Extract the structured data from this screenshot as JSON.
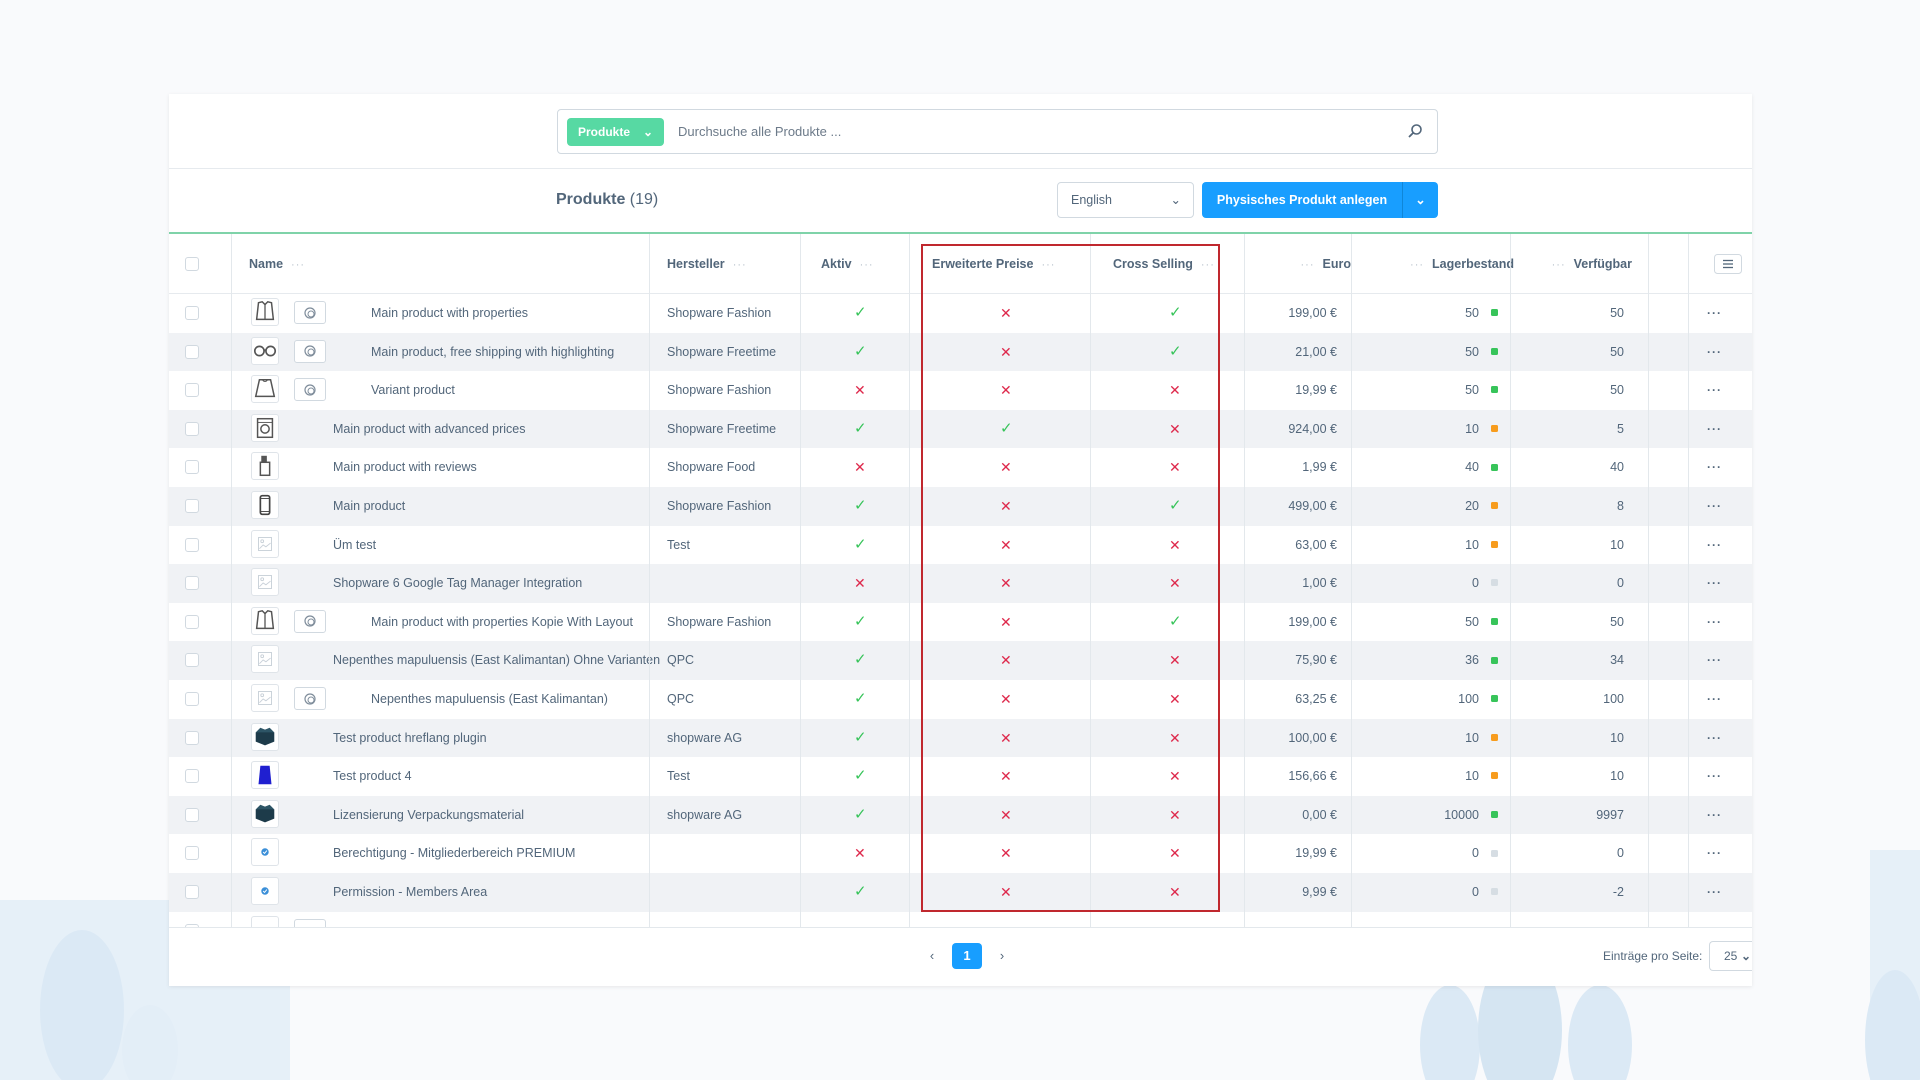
{
  "search": {
    "type_label": "Produkte",
    "placeholder": "Durchsuche alle Produkte ..."
  },
  "header": {
    "title": "Produkte",
    "count": "(19)",
    "language": "English",
    "create_button": "Physisches Produkt anlegen"
  },
  "columns": {
    "name": "Name",
    "manufacturer": "Hersteller",
    "active": "Aktiv",
    "advanced_prices": "Erweiterte Preise",
    "cross_selling": "Cross Selling",
    "price": "Euro",
    "stock": "Lagerbestand",
    "available": "Verfügbar"
  },
  "colors": {
    "accent": "#189eff",
    "success": "#37c45a",
    "danger": "#de294c",
    "warning": "#f79c1d",
    "neutral": "#d6dde3",
    "highlight_box": "#c0282e",
    "search_type": "#57d9a3"
  },
  "rows": [
    {
      "thumb": "jacket",
      "variant": true,
      "name": "Main product with properties",
      "manufacturer": "Shopware Fashion",
      "active": true,
      "advanced_prices": false,
      "cross_selling": true,
      "price": "199,00 €",
      "stock": "50",
      "stock_status": "green",
      "available": "50"
    },
    {
      "thumb": "glasses",
      "variant": true,
      "name": "Main product, free shipping with highlighting",
      "manufacturer": "Shopware Freetime",
      "active": true,
      "advanced_prices": false,
      "cross_selling": true,
      "price": "21,00 €",
      "stock": "50",
      "stock_status": "green",
      "available": "50"
    },
    {
      "thumb": "sweater",
      "variant": true,
      "name": "Variant product",
      "manufacturer": "Shopware Fashion",
      "active": false,
      "advanced_prices": false,
      "cross_selling": false,
      "price": "19,99 €",
      "stock": "50",
      "stock_status": "green",
      "available": "50"
    },
    {
      "thumb": "washer",
      "variant": false,
      "name": "Main product with advanced prices",
      "manufacturer": "Shopware Freetime",
      "active": true,
      "advanced_prices": true,
      "cross_selling": false,
      "price": "924,00 €",
      "stock": "10",
      "stock_status": "orange",
      "available": "5"
    },
    {
      "thumb": "bottle",
      "variant": false,
      "name": "Main product with reviews",
      "manufacturer": "Shopware Food",
      "active": false,
      "advanced_prices": false,
      "cross_selling": false,
      "price": "1,99 €",
      "stock": "40",
      "stock_status": "green",
      "available": "40"
    },
    {
      "thumb": "phone",
      "variant": false,
      "name": "Main product",
      "manufacturer": "Shopware Fashion",
      "active": true,
      "advanced_prices": false,
      "cross_selling": true,
      "price": "499,00 €",
      "stock": "20",
      "stock_status": "orange",
      "available": "8"
    },
    {
      "thumb": "placeholder",
      "variant": false,
      "name": "Üm test",
      "manufacturer": "Test",
      "active": true,
      "advanced_prices": false,
      "cross_selling": false,
      "price": "63,00 €",
      "stock": "10",
      "stock_status": "orange",
      "available": "10"
    },
    {
      "thumb": "placeholder",
      "variant": false,
      "name": "Shopware 6 Google Tag Manager Integration",
      "manufacturer": "",
      "active": false,
      "advanced_prices": false,
      "cross_selling": false,
      "price": "1,00 €",
      "stock": "0",
      "stock_status": "grey",
      "available": "0"
    },
    {
      "thumb": "jacket",
      "variant": true,
      "name": "Main product with properties Kopie With Layout",
      "manufacturer": "Shopware Fashion",
      "active": true,
      "advanced_prices": false,
      "cross_selling": true,
      "price": "199,00 €",
      "stock": "50",
      "stock_status": "green",
      "available": "50"
    },
    {
      "thumb": "placeholder",
      "variant": false,
      "name": "Nepenthes mapuluensis (East Kalimantan) Ohne Varianten",
      "manufacturer": "QPC",
      "active": true,
      "advanced_prices": false,
      "cross_selling": false,
      "price": "75,90 €",
      "stock": "36",
      "stock_status": "green",
      "available": "34"
    },
    {
      "thumb": "placeholder",
      "variant": true,
      "name": "Nepenthes mapuluensis (East Kalimantan)",
      "manufacturer": "QPC",
      "active": true,
      "advanced_prices": false,
      "cross_selling": false,
      "price": "63,25 €",
      "stock": "100",
      "stock_status": "green",
      "available": "100"
    },
    {
      "thumb": "box",
      "variant": false,
      "name": "Test product hreflang plugin",
      "manufacturer": "shopware AG",
      "active": true,
      "advanced_prices": false,
      "cross_selling": false,
      "price": "100,00 €",
      "stock": "10",
      "stock_status": "orange",
      "available": "10"
    },
    {
      "thumb": "shirt",
      "variant": false,
      "name": "Test product 4",
      "manufacturer": "Test",
      "active": true,
      "advanced_prices": false,
      "cross_selling": false,
      "price": "156,66 €",
      "stock": "10",
      "stock_status": "orange",
      "available": "10"
    },
    {
      "thumb": "box",
      "variant": false,
      "name": "Lizensierung Verpackungsmaterial",
      "manufacturer": "shopware AG",
      "active": true,
      "advanced_prices": false,
      "cross_selling": false,
      "price": "0,00 €",
      "stock": "10000",
      "stock_status": "green",
      "available": "9997"
    },
    {
      "thumb": "badge",
      "variant": false,
      "name": "Berechtigung - Mitgliederbereich PREMIUM",
      "manufacturer": "",
      "active": false,
      "advanced_prices": false,
      "cross_selling": false,
      "price": "19,99 €",
      "stock": "0",
      "stock_status": "grey",
      "available": "0"
    },
    {
      "thumb": "badge",
      "variant": false,
      "name": "Permission - Members Area",
      "manufacturer": "",
      "active": true,
      "advanced_prices": false,
      "cross_selling": false,
      "price": "9,99 €",
      "stock": "0",
      "stock_status": "grey",
      "available": "-2"
    }
  ],
  "pagination": {
    "current_page": "1",
    "per_page_label": "Einträge pro Seite:",
    "per_page": "25"
  }
}
